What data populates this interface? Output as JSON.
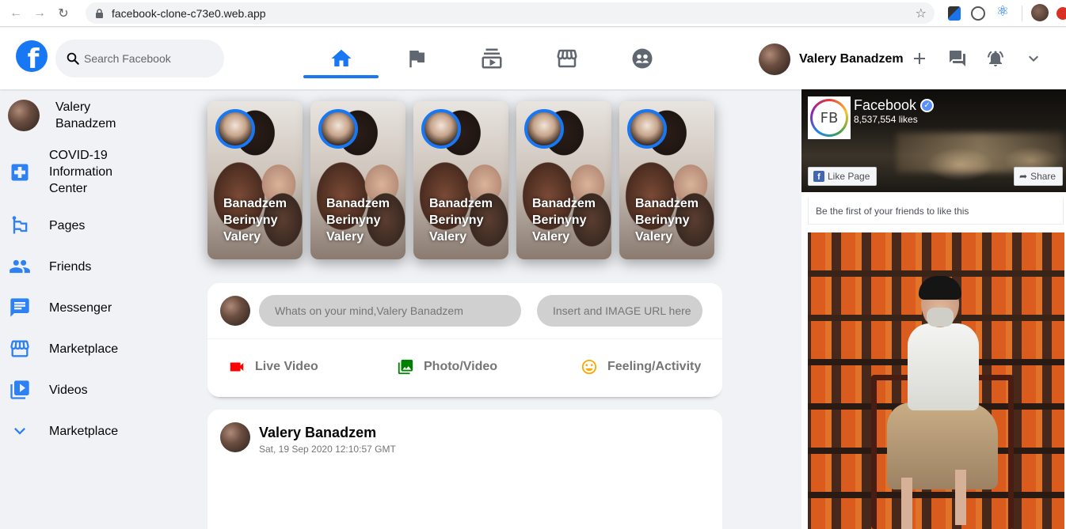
{
  "browser": {
    "url": "facebook-clone-c73e0.web.app"
  },
  "header": {
    "logo": "f",
    "search_placeholder": "Search Facebook",
    "user_name": "Valery Banadzem",
    "tabs": [
      {
        "icon": "home-icon",
        "active": true
      },
      {
        "icon": "flag-icon",
        "active": false
      },
      {
        "icon": "subscriptions-icon",
        "active": false
      },
      {
        "icon": "storefront-icon",
        "active": false
      },
      {
        "icon": "supervised-user-icon",
        "active": false
      }
    ],
    "accent": "#1877f2"
  },
  "sidebar": {
    "items": [
      {
        "label": "Valery\nBanadzem",
        "icon": "avatar"
      },
      {
        "label": "COVID-19\nInformation\nCenter",
        "icon": "local-hospital-icon"
      },
      {
        "label": "Pages",
        "icon": "emoji-flags-icon"
      },
      {
        "label": "Friends",
        "icon": "people-icon"
      },
      {
        "label": "Messenger",
        "icon": "chat-icon"
      },
      {
        "label": "Marketplace",
        "icon": "storefront-icon"
      },
      {
        "label": "Videos",
        "icon": "video-library-icon"
      },
      {
        "label": "Marketplace",
        "icon": "expand-more-icon"
      }
    ]
  },
  "stories": [
    {
      "name": "Banadzem\nBerinyny\nValery"
    },
    {
      "name": "Banadzem\nBerinyny\nValery"
    },
    {
      "name": "Banadzem\nBerinyny\nValery"
    },
    {
      "name": "Banadzem\nBerinyny\nValery"
    },
    {
      "name": "Banadzem\nBerinyny\nValery"
    }
  ],
  "composer": {
    "text_placeholder": "Whats on your mind,Valery Banadzem",
    "image_placeholder": "Insert and IMAGE URL here",
    "options": [
      {
        "label": "Live Video",
        "icon": "videocam-icon",
        "color": "#ff0000"
      },
      {
        "label": "Photo/Video",
        "icon": "photo-library-icon",
        "color": "#008000"
      },
      {
        "label": "Feeling/Activity",
        "icon": "insert-emoticon-icon",
        "color": "#ffa500"
      }
    ]
  },
  "post": {
    "username": "Valery Banadzem",
    "timestamp": "Sat, 19 Sep 2020 12:10:57 GMT"
  },
  "page_plugin": {
    "logo_text": "FB",
    "title": "Facebook",
    "likes": "8,537,554 likes",
    "like_button": "Like Page",
    "share_button": "Share",
    "first_like": "Be the first of your friends to like this"
  }
}
